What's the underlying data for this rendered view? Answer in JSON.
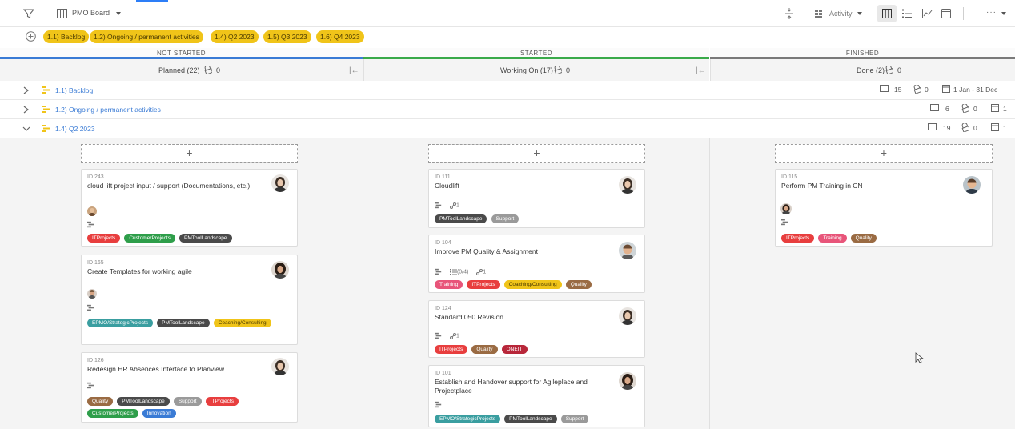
{
  "toolbar": {
    "board_title": "PMO Board",
    "activity_label": "Activity",
    "more_label": "···"
  },
  "chips": [
    {
      "label": "1.1) Backlog"
    },
    {
      "label": "1.2) Ongoing / permanent activities"
    },
    {
      "label": "1.4) Q2 2023"
    },
    {
      "label": "1.5) Q3 2023"
    },
    {
      "label": "1.6) Q4 2023"
    }
  ],
  "groups": [
    {
      "label": "NOT STARTED",
      "color": "#3a7bd5"
    },
    {
      "label": "STARTED",
      "color": "#3aaa4a"
    },
    {
      "label": "FINISHED",
      "color": "#7a7a7a"
    }
  ],
  "columns": [
    {
      "label": "Planned (22)",
      "count": "0"
    },
    {
      "label": "Working On (17)",
      "count": "0"
    },
    {
      "label": "Done (2)",
      "count": "0"
    }
  ],
  "lanes": [
    {
      "title": "1.1) Backlog",
      "cards": "15",
      "blocked": "0",
      "dates": "1 Jan - 31 Dec"
    },
    {
      "title": "1.2) Ongoing / permanent activities",
      "cards": "6",
      "blocked": "0",
      "dates": "1"
    },
    {
      "title": "1.4) Q2 2023",
      "cards": "19",
      "blocked": "0",
      "dates": "1"
    }
  ],
  "cards": {
    "c243": {
      "id": "ID 243",
      "title": "cloud lift project input / support (Documentations, etc.)"
    },
    "c165": {
      "id": "ID 165",
      "title": "Create Templates for working agile"
    },
    "c126": {
      "id": "ID 126",
      "title": "Redesign HR Absences Interface to Planview"
    },
    "c111": {
      "id": "ID 111",
      "title": "Cloudlift",
      "children": "1"
    },
    "c104": {
      "id": "ID 104",
      "title": "Improve PM Quality & Assignment",
      "checklist": "(0/4)",
      "children": "1"
    },
    "c124": {
      "id": "ID 124",
      "title": "Standard 050 Revision",
      "children": "1"
    },
    "c101": {
      "id": "ID 101",
      "title": "Establish and Handover support for Agileplace and Projectplace"
    },
    "c115": {
      "id": "ID 115",
      "title": "Perform PM Training in CN"
    }
  },
  "tags": {
    "itprojects": "ITProjects",
    "customerprojects": "CustomerProjects",
    "pmtoollandscape": "PMToolLandscape",
    "epmo": "EPMO/StrategicProjects",
    "coaching": "Coaching/Consulting",
    "quality": "Quality",
    "support": "Support",
    "innovation": "Innovation",
    "training": "Training",
    "oneit": "ONEIT"
  },
  "colors": {
    "itprojects": "#e83e3e",
    "customerprojects": "#2e9e4a",
    "pmtoollandscape": "#4a4a4a",
    "epmo": "#3a9ea0",
    "coaching": "#f0c419",
    "quality": "#9a6b43",
    "support": "#9a9a9a",
    "innovation": "#3a7bd5",
    "training": "#e8557a",
    "oneit": "#b8273a",
    "chip": "#f0c419"
  }
}
